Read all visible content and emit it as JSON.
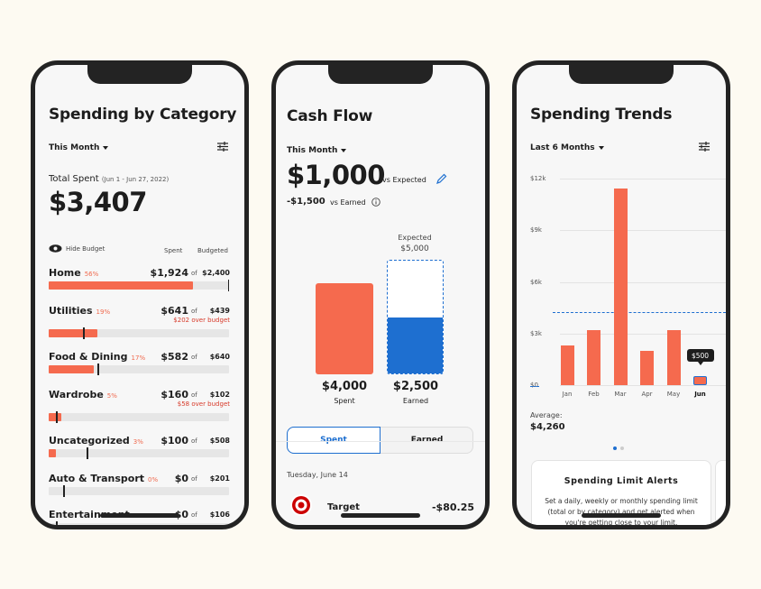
{
  "spending": {
    "title": "Spending by Category",
    "period": "This Month",
    "total_label": "Total Spent",
    "total_range": "(Jun 1 - Jun 27, 2022)",
    "total_value": "$3,407",
    "hide_budget": "Hide Budget",
    "col_spent": "Spent",
    "col_budgeted": "Budgeted",
    "of": "of",
    "categories": [
      {
        "name": "Home",
        "pct": "56%",
        "spent": "$1,924",
        "budget": "$2,400",
        "over": "",
        "fill": 0.8,
        "marker": 1.0
      },
      {
        "name": "Utilities",
        "pct": "19%",
        "spent": "$641",
        "budget": "$439",
        "over": "$202 over budget",
        "fill": 0.27,
        "marker": 0.19
      },
      {
        "name": "Food & Dining",
        "pct": "17%",
        "spent": "$582",
        "budget": "$640",
        "over": "",
        "fill": 0.25,
        "marker": 0.27
      },
      {
        "name": "Wardrobe",
        "pct": "5%",
        "spent": "$160",
        "budget": "$102",
        "over": "$58 over budget",
        "fill": 0.07,
        "marker": 0.04
      },
      {
        "name": "Uncategorized",
        "pct": "3%",
        "spent": "$100",
        "budget": "$508",
        "over": "",
        "fill": 0.04,
        "marker": 0.21
      },
      {
        "name": "Auto & Transport",
        "pct": "0%",
        "spent": "$0",
        "budget": "$201",
        "over": "",
        "fill": 0.0,
        "marker": 0.08
      },
      {
        "name": "Entertainment",
        "pct": "0%",
        "spent": "$0",
        "budget": "$106",
        "over": "",
        "fill": 0.0,
        "marker": 0.04
      }
    ]
  },
  "cashflow": {
    "title": "Cash Flow",
    "period": "This Month",
    "value": "$1,000",
    "vs_expected": "vs Expected",
    "earned_delta": "-$1,500",
    "vs_earned": "vs Earned",
    "expected_label": "Expected",
    "expected_value": "$5,000",
    "spent_value": "$4,000",
    "spent_label": "Spent",
    "earned_value": "$2,500",
    "earned_label": "Earned",
    "earned_fraction": 0.5,
    "tab_spent": "Spent",
    "tab_earned": "Earned",
    "date": "Tuesday, June 14",
    "tx_name": "Target",
    "tx_amount": "-$80.25"
  },
  "trends": {
    "title": "Spending Trends",
    "period": "Last 6 Months",
    "average_label": "Average:",
    "average_value": "$4,260",
    "tooltip": "$500",
    "alert_title": "Spending Limit Alerts",
    "alert_text": "Set a daily, weekly or monthly spending limit (total or by category) and get alerted when you're getting close to your limit."
  },
  "chart_data": {
    "type": "bar",
    "categories": [
      "Jan",
      "Feb",
      "Mar",
      "Apr",
      "May",
      "Jun"
    ],
    "values": [
      2300,
      3200,
      11400,
      2000,
      3200,
      500
    ],
    "y_ticks": [
      "$12k",
      "$9k",
      "$6k",
      "$3k",
      "$0"
    ],
    "ylim": [
      0,
      12000
    ],
    "average": 4260,
    "colors": {
      "bar": "#f56a4e",
      "average_line": "#1e6fd0"
    }
  }
}
